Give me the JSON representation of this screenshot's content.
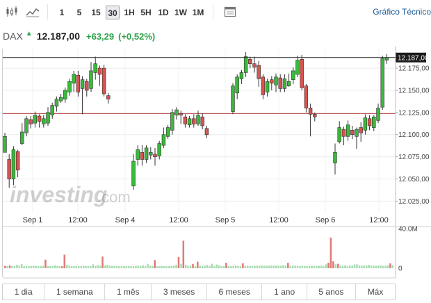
{
  "toolbar": {
    "chart_type_icons": [
      "candlestick-icon",
      "line-chart-icon"
    ],
    "intervals": [
      "1",
      "5",
      "15",
      "30",
      "1H",
      "5H",
      "1D",
      "1W",
      "1M"
    ],
    "active_interval": "30",
    "calendar_icon": "calendar-icon",
    "grafico_label": "Gráfico Técnico"
  },
  "quote": {
    "symbol": "DAX",
    "price": "12.187,00",
    "change": "+63,29",
    "change_pct": "(+0,52%)",
    "up_color": "#2ea34a"
  },
  "watermark": {
    "brand": "investing",
    "suffix": ".com"
  },
  "chart_data": {
    "type": "candlestick",
    "x_tick_labels": [
      "Sep 1",
      "12:00",
      "Sep 4",
      "12:00",
      "Sep 5",
      "12:00",
      "Sep 6",
      "12:00"
    ],
    "y_tick_labels": [
      "12.175,00",
      "12.150,00",
      "12.125,00",
      "12.100,00",
      "12.075,00",
      "12.050,00",
      "12.025,00"
    ],
    "y_tick_values": [
      12175,
      12150,
      12125,
      12100,
      12075,
      12050,
      12025
    ],
    "ylim": [
      12012,
      12197
    ],
    "current_price_label": "12.187,00",
    "current_price": 12187,
    "previous_close": 12123.7,
    "volume_axis_labels": [
      "40.0M",
      "0"
    ],
    "volume_axis_max": 40,
    "up_color": "#3cb83c",
    "down_color": "#d9534f",
    "candles": [
      [
        12080,
        12098,
        12080,
        12102
      ],
      [
        12072,
        12050,
        12040,
        12078
      ],
      [
        12050,
        12083,
        12043,
        12087
      ],
      [
        12081,
        12060,
        12052,
        12083
      ],
      [
        12090,
        12103,
        12088,
        12113
      ],
      [
        12102,
        12118,
        12098,
        12121
      ],
      [
        12117,
        12112,
        12107,
        12121
      ],
      [
        12113,
        12122,
        12108,
        12126
      ],
      [
        12121,
        12115,
        12108,
        12123
      ],
      [
        12112,
        12118,
        12108,
        12122
      ],
      [
        12113,
        12125,
        12110,
        12131
      ],
      [
        12122,
        12133,
        12118,
        12136
      ],
      [
        12132,
        12140,
        12126,
        12143
      ],
      [
        12138,
        12142,
        12136,
        12146
      ],
      [
        12140,
        12150,
        12136,
        12153
      ],
      [
        12148,
        12160,
        12144,
        12163
      ],
      [
        12158,
        12168,
        12148,
        12172
      ],
      [
        12167,
        12148,
        12143,
        12172
      ],
      [
        12152,
        12162,
        12123,
        12166
      ],
      [
        12160,
        12150,
        12143,
        12163
      ],
      [
        12152,
        12172,
        12148,
        12182
      ],
      [
        12170,
        12180,
        12162,
        12188
      ],
      [
        12175,
        12168,
        12155,
        12178
      ],
      [
        12175,
        12146,
        12143,
        12179
      ],
      [
        12144,
        12140,
        12135,
        12147
      ],
      [
        12042,
        12070,
        12038,
        12078
      ],
      [
        12072,
        12083,
        12065,
        12088
      ],
      [
        12080,
        12072,
        12065,
        12088
      ],
      [
        12072,
        12085,
        12068,
        12088
      ],
      [
        12077,
        12080,
        12072,
        12086
      ],
      [
        12078,
        12075,
        12065,
        12085
      ],
      [
        12076,
        12090,
        12072,
        12093
      ],
      [
        12088,
        12100,
        12085,
        12108
      ],
      [
        12098,
        12108,
        12095,
        12111
      ],
      [
        12105,
        12125,
        12100,
        12129
      ],
      [
        12122,
        12128,
        12117,
        12131
      ],
      [
        12124,
        12122,
        12112,
        12127
      ],
      [
        12120,
        12112,
        12108,
        12123
      ],
      [
        12111,
        12118,
        12108,
        12121
      ],
      [
        12118,
        12112,
        12108,
        12123
      ],
      [
        12112,
        12122,
        12110,
        12127
      ],
      [
        12120,
        12110,
        12106,
        12124
      ],
      [
        12107,
        12100,
        12096,
        12110
      ],
      [
        12126,
        12155,
        12123,
        12158
      ],
      [
        12147,
        12165,
        12140,
        12168
      ],
      [
        12163,
        12170,
        12157,
        12173
      ],
      [
        12170,
        12188,
        12165,
        12193
      ],
      [
        12185,
        12180,
        12175,
        12188
      ],
      [
        12180,
        12176,
        12170,
        12188
      ],
      [
        12178,
        12163,
        12154,
        12183
      ],
      [
        12165,
        12145,
        12140,
        12168
      ],
      [
        12148,
        12160,
        12143,
        12163
      ],
      [
        12162,
        12158,
        12150,
        12166
      ],
      [
        12156,
        12165,
        12148,
        12169
      ],
      [
        12164,
        12152,
        12148,
        12168
      ],
      [
        12152,
        12163,
        12148,
        12168
      ],
      [
        12155,
        12160,
        12154,
        12169
      ],
      [
        12162,
        12172,
        12157,
        12176
      ],
      [
        12168,
        12184,
        12165,
        12189
      ],
      [
        12185,
        12153,
        12150,
        12190
      ],
      [
        12155,
        12130,
        12125,
        12157
      ],
      [
        12130,
        12123,
        12098,
        12135
      ],
      [
        12123,
        12120,
        12115,
        12125
      ],
      [
        12068,
        12080,
        12055,
        12090
      ],
      [
        12092,
        12108,
        12090,
        12115
      ],
      [
        12106,
        12098,
        12088,
        12109
      ],
      [
        12098,
        12111,
        12093,
        12116
      ],
      [
        12105,
        12100,
        12095,
        12110
      ],
      [
        12098,
        12106,
        12084,
        12108
      ],
      [
        12108,
        12102,
        12092,
        12114
      ],
      [
        12105,
        12119,
        12100,
        12123
      ],
      [
        12118,
        12110,
        12105,
        12122
      ],
      [
        12108,
        12120,
        12104,
        12122
      ],
      [
        12116,
        12130,
        12113,
        12135
      ],
      [
        12131,
        12186,
        12128,
        12189
      ],
      [
        12184,
        12187,
        12180,
        12191
      ]
    ],
    "volumes": [
      2.4,
      2.2,
      2.9,
      2.1,
      2.2,
      3.5,
      2.5,
      4.3,
      2.3,
      2.0,
      2.1,
      2.4,
      2.6,
      2.2,
      2.0,
      2.3,
      2.5,
      8.6,
      2.4,
      2.2,
      2.2,
      3.1,
      2.2,
      2.2,
      2.0,
      13.7,
      3.5,
      2.5,
      2.2,
      2.1,
      2.3,
      2.0,
      2.2,
      2.5,
      2.4,
      2.3,
      2.2,
      4.0,
      2.2,
      3.2,
      2.5,
      11.8,
      2.8,
      3.5,
      2.8,
      2.4,
      2.5,
      2.1,
      2.2,
      2.1,
      2.2,
      2.2,
      2.3,
      2.2,
      2.0,
      2.5,
      2.7,
      2.3,
      3.0,
      2.2,
      4.2,
      2.6,
      2.4,
      8.2,
      2.0,
      2.3,
      2.3,
      2.2,
      2.0,
      2.2,
      2.3,
      2.6,
      3.5,
      11.2,
      4.6,
      27.8,
      3.5,
      2.3,
      2.7,
      4.4,
      2.4,
      6.6,
      2.5,
      2.2,
      2.4,
      3.3,
      2.4,
      4.5,
      2.0,
      3.8,
      2.8,
      2.2,
      2.2,
      5.6,
      2.4,
      2.1,
      2.3,
      2.9,
      2.3,
      2.2,
      5.0,
      2.5,
      2.6,
      2.4,
      2.3,
      2.4,
      2.5,
      2.5,
      2.6,
      2.5,
      2.6,
      2.4,
      2.8,
      2.5,
      2.5,
      2.7,
      2.6,
      3.1,
      2.6,
      5.5,
      2.4,
      2.7,
      2.6,
      2.4,
      2.2,
      2.5,
      2.1,
      2.3,
      2.3,
      2.6,
      2.4,
      2.4,
      2.5,
      2.6,
      2.2,
      3.9,
      5.6,
      31.0,
      7.0,
      4.0,
      4.5,
      2.7,
      2.4,
      3.1,
      2.2,
      2.8,
      2.6,
      3.8,
      4.0,
      2.8,
      2.6,
      2.6,
      2.8,
      3.5,
      2.6,
      2.6,
      2.5,
      2.7,
      2.8,
      2.2,
      2.5,
      3.0,
      5.0,
      3.2
    ],
    "volume_colors_are_up": [
      false,
      true,
      false,
      true,
      true,
      true,
      true,
      true,
      true,
      true,
      true,
      true,
      true,
      true,
      true,
      true,
      true,
      false,
      true,
      true,
      true,
      true,
      true,
      true,
      false,
      false,
      true,
      true,
      true,
      true,
      true,
      true,
      true,
      true,
      true,
      true,
      true,
      true,
      true,
      true,
      true,
      false,
      true,
      true,
      true,
      true,
      true,
      true,
      true,
      true,
      true,
      true,
      true,
      true,
      true,
      true,
      true,
      true,
      true,
      true,
      true,
      true,
      true,
      false,
      true,
      true,
      true,
      true,
      true,
      true,
      true,
      true,
      true,
      false,
      true,
      false,
      true,
      true,
      true,
      false,
      true,
      false,
      true,
      true,
      true,
      true,
      true,
      true,
      true,
      true,
      true,
      true,
      true,
      false,
      true,
      true,
      true,
      true,
      true,
      true,
      false,
      true,
      true,
      true,
      true,
      true,
      true,
      true,
      true,
      true,
      true,
      true,
      true,
      true,
      true,
      true,
      true,
      true,
      true,
      false,
      true,
      true,
      true,
      true,
      true,
      true,
      true,
      true,
      true,
      true,
      true,
      true,
      true,
      true,
      true,
      true,
      false,
      false,
      false,
      true,
      false,
      true,
      true,
      true,
      true,
      true,
      true,
      true,
      true,
      true,
      true,
      true,
      true,
      true,
      true,
      true,
      true,
      true,
      true,
      true,
      true,
      true,
      false,
      true
    ]
  },
  "periods": [
    "1 dia",
    "1 semana",
    "1 mês",
    "3 meses",
    "6 meses",
    "1 ano",
    "5 anos",
    "Máx"
  ]
}
